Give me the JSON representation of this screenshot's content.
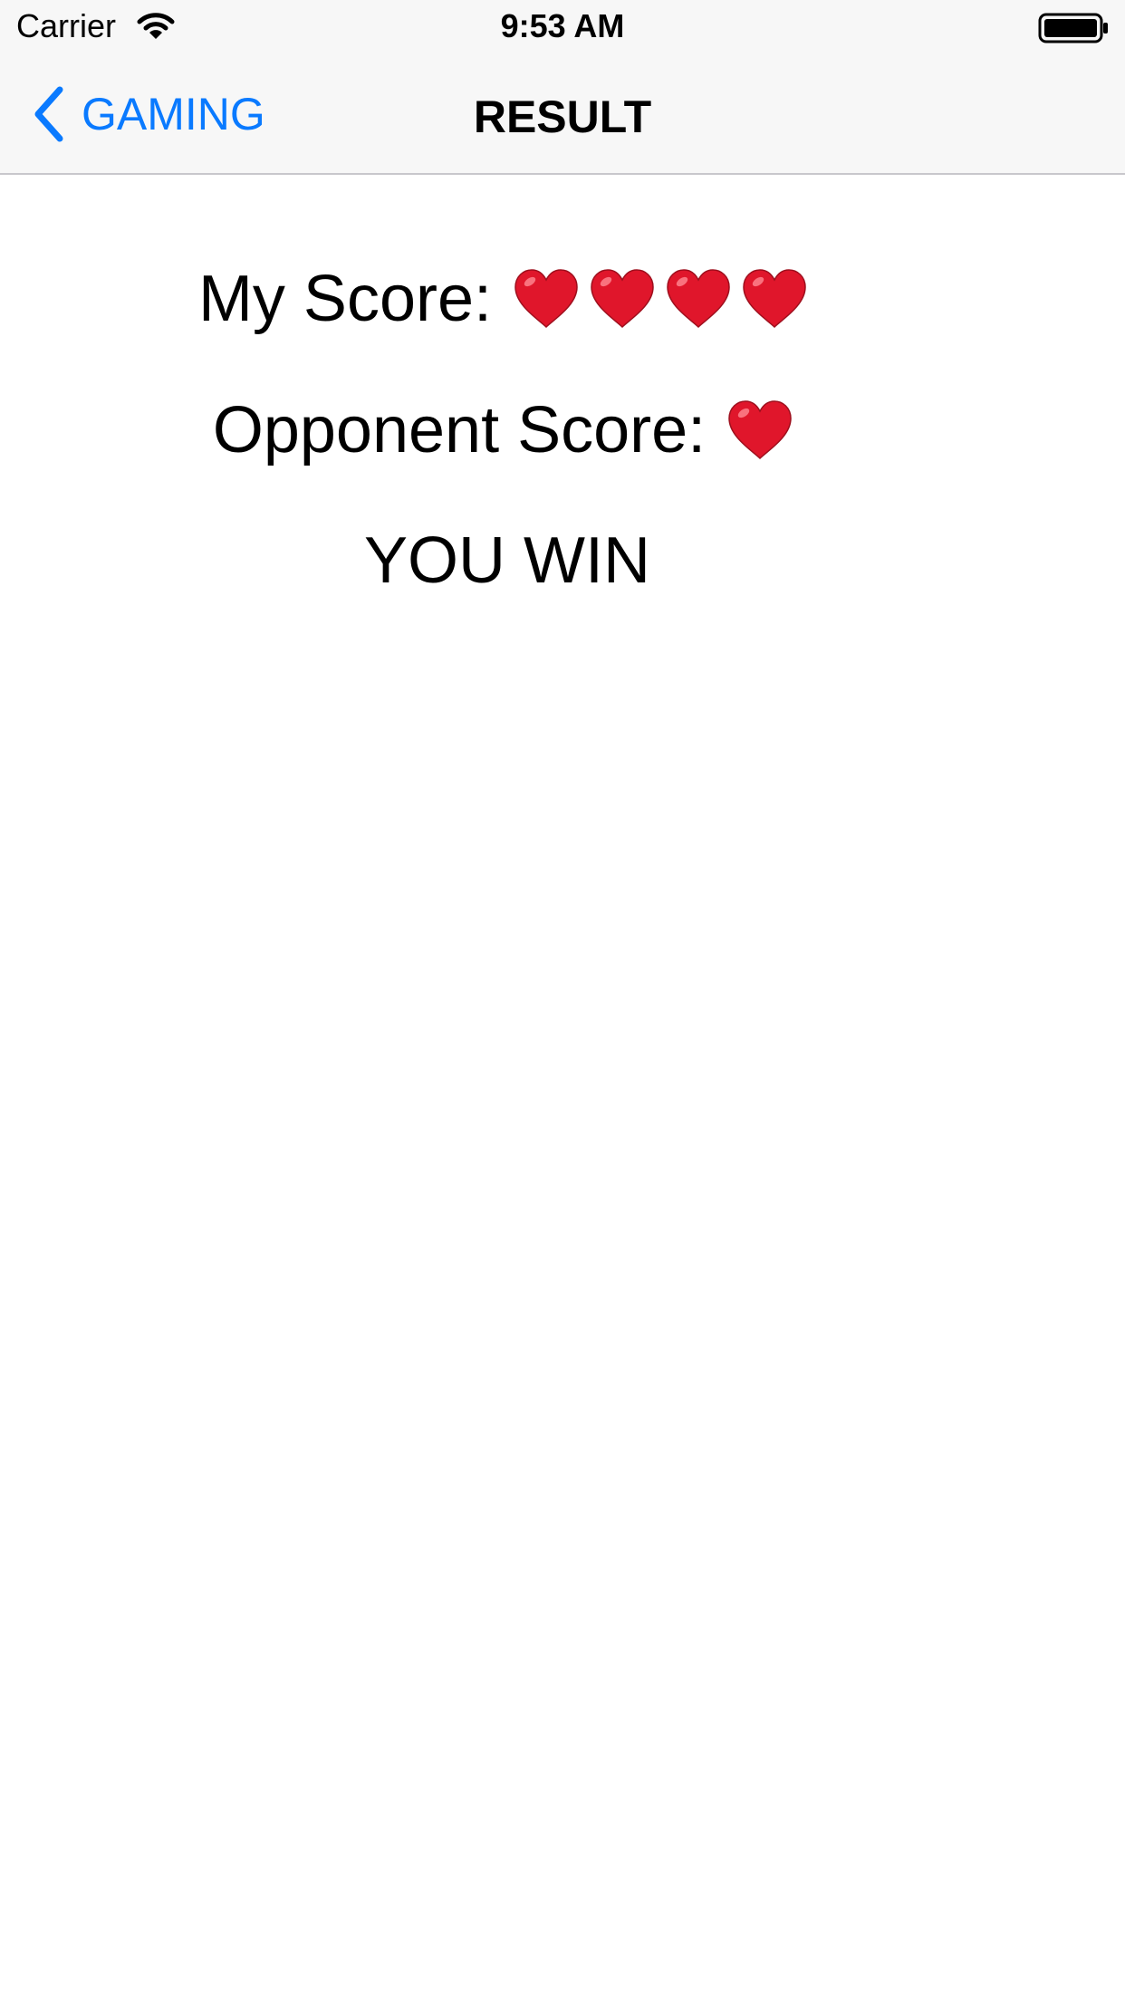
{
  "status_bar": {
    "carrier": "Carrier",
    "time": "9:53 AM",
    "icons": [
      "wifi-icon",
      "battery-icon"
    ]
  },
  "nav": {
    "back_label": "GAMING",
    "title": "RESULT",
    "accent_color": "#0a7aff",
    "back_icon": "chevron-left-icon"
  },
  "scores": {
    "my_label": "My Score:",
    "my_hearts": 4,
    "opponent_label": "Opponent Score:",
    "opponent_hearts": 1,
    "heart_icon": "heart-icon",
    "heart_color": "#e0162b"
  },
  "result": {
    "text": "YOU WIN"
  }
}
